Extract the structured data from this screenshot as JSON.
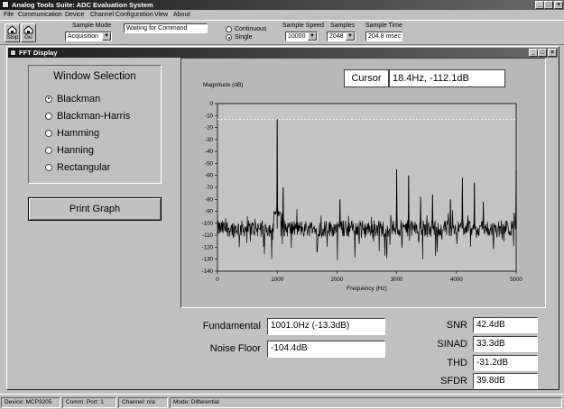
{
  "app": {
    "title": "Analog Tools Suite: ADC Evaluation System",
    "window_controls": [
      "_",
      "□",
      "×"
    ]
  },
  "menu": [
    "File",
    "Communication",
    "Device",
    "Channel Configuration",
    "View",
    "About"
  ],
  "toolbar": {
    "stop_label": "Stop",
    "go_label": "Go",
    "sample_mode_label": "Sample Mode",
    "sample_mode_value": "Acquisition",
    "status_text": "Waiting for Command",
    "radio_continuous": "Continuous",
    "radio_single": "Single",
    "selected_mode": "Single",
    "sample_speed_label": "Sample Speed",
    "sample_speed_value": "10000",
    "samples_label": "Samples",
    "samples_value": "2048",
    "sample_time_label": "Sample Time",
    "sample_time_value": "204.8 msec"
  },
  "fft_window": {
    "title": "FFT Display",
    "window_selection_title": "Window Selection",
    "windows": [
      "Blackman",
      "Blackman-Harris",
      "Hamming",
      "Hanning",
      "Rectangular"
    ],
    "selected_window": "Blackman",
    "print_button": "Print Graph",
    "cursor_label": "Cursor",
    "cursor_value": "18.4Hz, -112.1dB"
  },
  "measurements": {
    "fundamental_label": "Fundamental",
    "fundamental_value": "1001.0Hz (-13.3dB)",
    "noise_floor_label": "Noise Floor",
    "noise_floor_value": "-104.4dB",
    "snr_label": "SNR",
    "snr_value": "42.4dB",
    "sinad_label": "SINAD",
    "sinad_value": "33.3dB",
    "thd_label": "THD",
    "thd_value": "-31.2dB",
    "sfdr_label": "SFDR",
    "sfdr_value": "39.8dB"
  },
  "status_bar": [
    "Device: MCP3205",
    "Comm. Port: 1",
    "Channel: n/a",
    "Mode: Differential"
  ],
  "chart_data": {
    "type": "line",
    "ylabel": "Magnitude (dB)",
    "xlabel": "Frequency (Hz)",
    "xlim": [
      0,
      5000
    ],
    "ylim": [
      -140,
      0
    ],
    "xticks": [
      0,
      1000,
      2000,
      3000,
      4000,
      5000
    ],
    "yticks": [
      0,
      -10,
      -20,
      -30,
      -40,
      -50,
      -60,
      -70,
      -80,
      -90,
      -100,
      -110,
      -120,
      -130,
      -140
    ],
    "reference_line_db": -13.3,
    "noise_floor_db": -104.4,
    "peaks": [
      {
        "x": 1000,
        "y": -13
      },
      {
        "x": 1100,
        "y": -70
      },
      {
        "x": 2050,
        "y": -80
      },
      {
        "x": 3000,
        "y": -55
      },
      {
        "x": 3200,
        "y": -60
      },
      {
        "x": 3400,
        "y": -78
      },
      {
        "x": 3600,
        "y": -76
      },
      {
        "x": 3900,
        "y": -80
      },
      {
        "x": 4100,
        "y": -62
      },
      {
        "x": 4300,
        "y": -66
      },
      {
        "x": 4450,
        "y": -82
      },
      {
        "x": 5000,
        "y": -55
      }
    ]
  }
}
